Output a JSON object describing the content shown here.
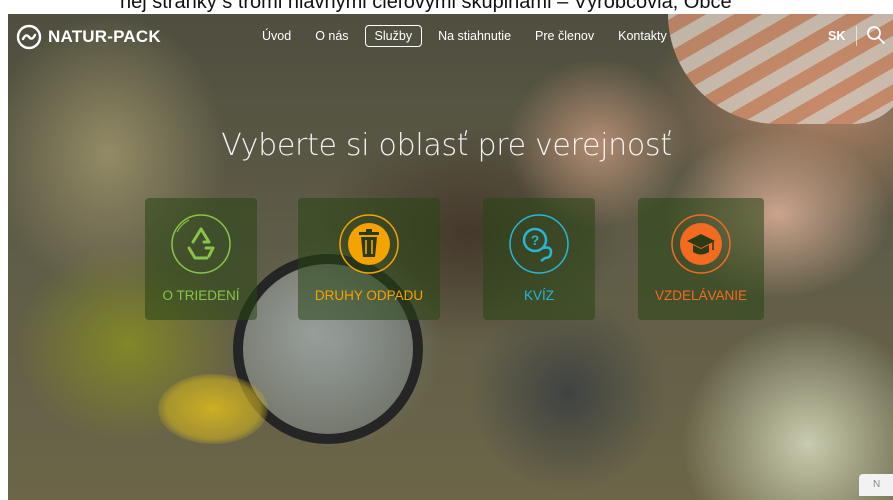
{
  "caption": "nej stránky s tromi hlavnými cieľovými skupinami – Výrobcovia, Obce",
  "brand": {
    "name": "NATUR-PACK",
    "color": "#ffffff"
  },
  "nav": {
    "items": [
      {
        "label": "Úvod"
      },
      {
        "label": "O nás"
      },
      {
        "label": "Služby",
        "active": true
      },
      {
        "label": "Na stiahnutie"
      },
      {
        "label": "Pre členov"
      },
      {
        "label": "Kontakty"
      }
    ],
    "lang": "SK",
    "search_icon": "search-icon"
  },
  "hero": {
    "headline": "Vyberte si oblasť pre verejnosť"
  },
  "tiles": [
    {
      "label": "O TRIEDENÍ",
      "icon": "recycle-icon",
      "color": "#8bc34a"
    },
    {
      "label": "DRUHY ODPADU",
      "icon": "trash-bin-icon",
      "color": "#f5a300"
    },
    {
      "label": "KVÍZ",
      "icon": "chat-question-icon",
      "color": "#29b6d6"
    },
    {
      "label": "VZDELÁVANIE",
      "icon": "graduation-cap-icon",
      "color": "#f26b21"
    }
  ],
  "corner_badge": "N"
}
